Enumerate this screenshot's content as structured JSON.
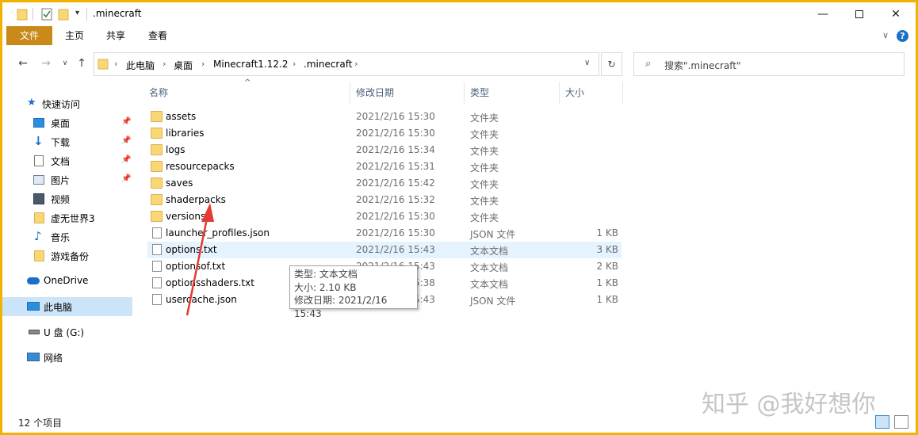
{
  "window": {
    "title": ".minecraft"
  },
  "ribbon": {
    "tabs": [
      "文件",
      "主页",
      "共享",
      "查看"
    ],
    "help": "?"
  },
  "address": {
    "crumbs": [
      "此电脑",
      "桌面",
      "Minecraft1.12.2",
      ".minecraft"
    ]
  },
  "search": {
    "placeholder": "搜索\".minecraft\""
  },
  "sidebar": {
    "items": [
      {
        "label": "快速访问",
        "icon": "star-icon"
      },
      {
        "label": "桌面",
        "icon": "desktop-icon",
        "pinned": true
      },
      {
        "label": "下载",
        "icon": "download-icon",
        "pinned": true
      },
      {
        "label": "文档",
        "icon": "document-icon",
        "pinned": true
      },
      {
        "label": "图片",
        "icon": "picture-icon",
        "pinned": true
      },
      {
        "label": "视频",
        "icon": "video-icon"
      },
      {
        "label": "虚无世界3",
        "icon": "folder-icon"
      },
      {
        "label": "音乐",
        "icon": "music-icon"
      },
      {
        "label": "游戏备份",
        "icon": "folder-icon"
      },
      {
        "label": "OneDrive",
        "icon": "cloud-icon"
      },
      {
        "label": "此电脑",
        "icon": "computer-icon",
        "selected": true
      },
      {
        "label": "U 盘 (G:)",
        "icon": "drive-icon"
      },
      {
        "label": "网络",
        "icon": "network-icon"
      }
    ]
  },
  "columns": {
    "name": "名称",
    "modified": "修改日期",
    "type": "类型",
    "size": "大小"
  },
  "files": [
    {
      "name": "assets",
      "modified": "2021/2/16 15:30",
      "type": "文件夹",
      "size": "",
      "kind": "folder"
    },
    {
      "name": "libraries",
      "modified": "2021/2/16 15:30",
      "type": "文件夹",
      "size": "",
      "kind": "folder"
    },
    {
      "name": "logs",
      "modified": "2021/2/16 15:34",
      "type": "文件夹",
      "size": "",
      "kind": "folder"
    },
    {
      "name": "resourcepacks",
      "modified": "2021/2/16 15:31",
      "type": "文件夹",
      "size": "",
      "kind": "folder"
    },
    {
      "name": "saves",
      "modified": "2021/2/16 15:42",
      "type": "文件夹",
      "size": "",
      "kind": "folder"
    },
    {
      "name": "shaderpacks",
      "modified": "2021/2/16 15:32",
      "type": "文件夹",
      "size": "",
      "kind": "folder"
    },
    {
      "name": "versions",
      "modified": "2021/2/16 15:30",
      "type": "文件夹",
      "size": "",
      "kind": "folder"
    },
    {
      "name": "launcher_profiles.json",
      "modified": "2021/2/16 15:30",
      "type": "JSON 文件",
      "size": "1 KB",
      "kind": "file"
    },
    {
      "name": "options.txt",
      "modified": "2021/2/16 15:43",
      "type": "文本文档",
      "size": "3 KB",
      "kind": "file",
      "hover": true
    },
    {
      "name": "optionsof.txt",
      "modified": "2021/2/16 15:43",
      "type": "文本文档",
      "size": "2 KB",
      "kind": "file"
    },
    {
      "name": "optionsshaders.txt",
      "modified": "2021/2/16 15:38",
      "type": "文本文档",
      "size": "1 KB",
      "kind": "file"
    },
    {
      "name": "usercache.json",
      "modified": "2021/2/16 15:43",
      "type": "JSON 文件",
      "size": "1 KB",
      "kind": "file"
    }
  ],
  "tooltip": {
    "line1": "类型: 文本文档",
    "line2": "大小: 2.10 KB",
    "line3": "修改日期: 2021/2/16 15:43"
  },
  "status": {
    "count": "12 个项目"
  },
  "watermark": "知乎 @我好想你",
  "colors": {
    "accent": "#f0b400",
    "file_tab": "#c98a1a",
    "arrow": "#e53935",
    "selection": "#cce4f7",
    "hover": "#e5f3ff"
  }
}
